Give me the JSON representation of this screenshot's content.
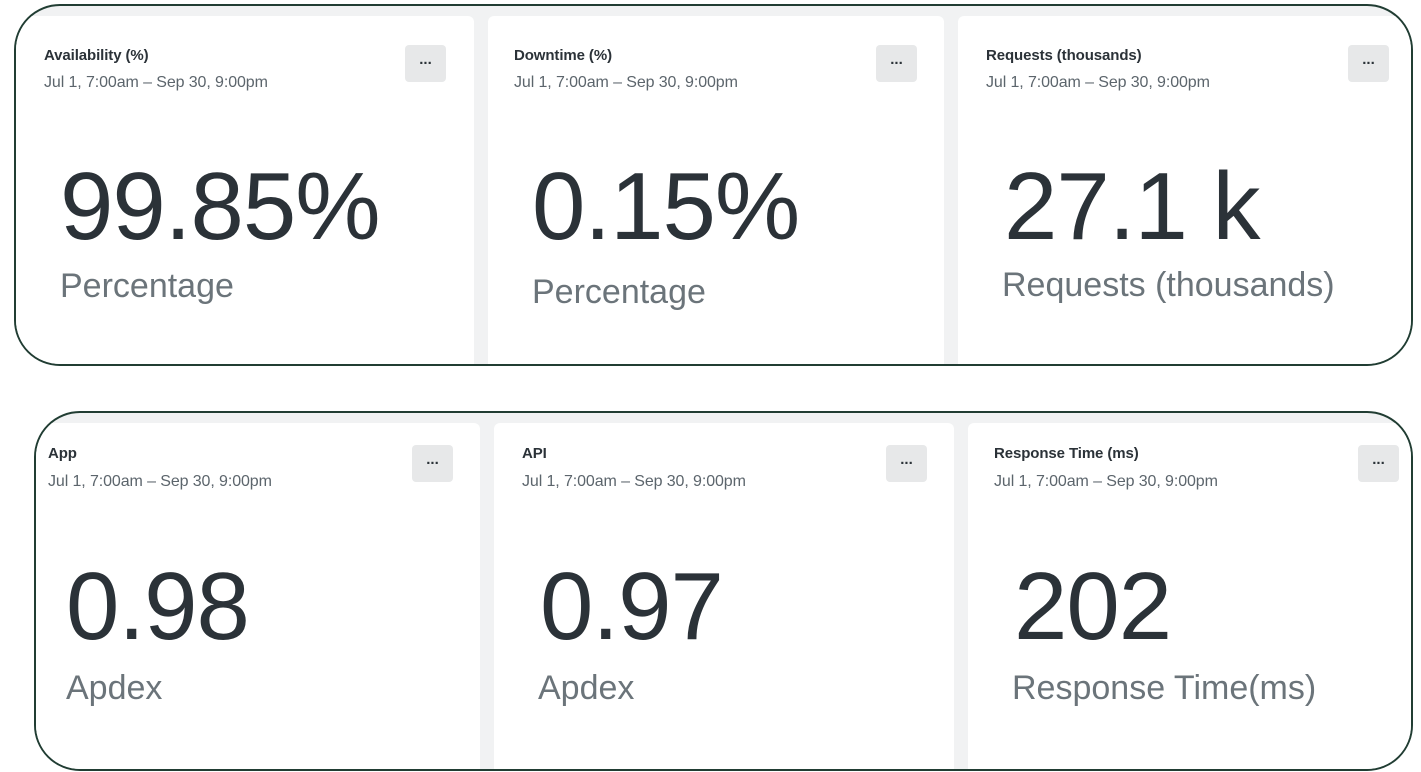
{
  "top_row": [
    {
      "title": "Availability (%)",
      "range": "Jul 1, 7:00am – Sep 30, 9:00pm",
      "value": "99.85%",
      "unit": "Percentage",
      "menu": "..."
    },
    {
      "title": "Downtime (%)",
      "range": "Jul 1, 7:00am – Sep 30, 9:00pm",
      "value": "0.15%",
      "unit": "Percentage",
      "menu": "..."
    },
    {
      "title": "Requests (thousands)",
      "range": "Jul 1, 7:00am – Sep 30, 9:00pm",
      "value": "27.1 k",
      "unit": "Requests (thousands)",
      "menu": "..."
    }
  ],
  "bottom_row": [
    {
      "title": "App",
      "range": "Jul 1, 7:00am – Sep 30, 9:00pm",
      "value": "0.98",
      "unit": "Apdex",
      "menu": "..."
    },
    {
      "title": "API",
      "range": "Jul 1, 7:00am – Sep 30, 9:00pm",
      "value": "0.97",
      "unit": "Apdex",
      "menu": "..."
    },
    {
      "title": "Response Time (ms)",
      "range": "Jul 1, 7:00am – Sep 30, 9:00pm",
      "value": "202",
      "unit": "Response Time(ms)",
      "menu": "..."
    }
  ],
  "colors": {
    "group_border": "#213d33",
    "panel_background": "#f1f2f3",
    "card_background": "#ffffff",
    "value_text": "#2b3238",
    "unit_text": "#6b747a"
  }
}
